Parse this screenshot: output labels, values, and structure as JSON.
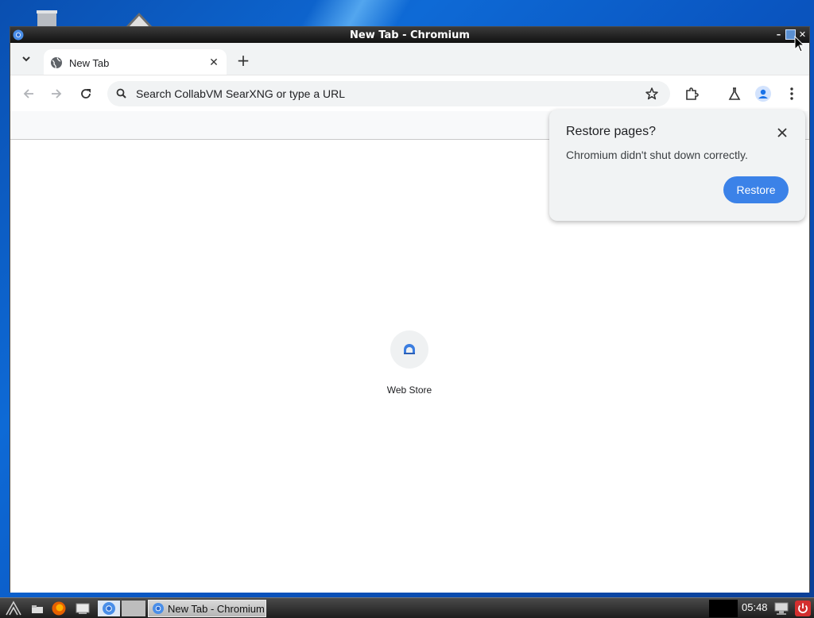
{
  "window": {
    "title": "New Tab - Chromium",
    "controls": [
      "minimize",
      "maximize",
      "close"
    ]
  },
  "tabstrip": {
    "tabs": [
      {
        "title": "New Tab",
        "active": true
      }
    ]
  },
  "toolbar": {
    "omnibox_placeholder": "Search CollabVM SearXNG or type a URL",
    "buttons": [
      "back",
      "forward",
      "reload",
      "bookmark-star",
      "extensions",
      "labs",
      "profile",
      "menu"
    ]
  },
  "new_tab_page": {
    "shortcuts": [
      {
        "label": "Web Store"
      }
    ]
  },
  "restore_popup": {
    "title": "Restore pages?",
    "message": "Chromium didn't shut down correctly.",
    "button": "Restore"
  },
  "taskbar": {
    "task_label": "New Tab - Chromium",
    "clock": "05:48"
  },
  "colors": {
    "accent": "#3b82e8",
    "profile_blue": "#1a73e8"
  }
}
